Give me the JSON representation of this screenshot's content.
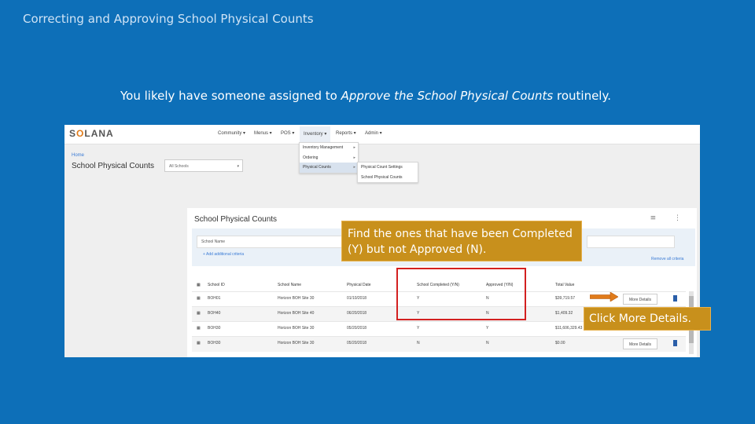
{
  "slide": {
    "title": "Correcting and Approving  School Physical Counts",
    "subtitle_pre": "You likely have someone assigned to ",
    "subtitle_em": "Approve the School Physical Counts",
    "subtitle_post": " routinely."
  },
  "app": {
    "logo_pre": "S",
    "logo_o": "O",
    "logo_post": "LANA",
    "nav": [
      "Community ▾",
      "Menus ▾",
      "POS ▾",
      "Inventory ▾",
      "Reports ▾",
      "Admin ▾"
    ],
    "inventory_menu": [
      {
        "label": "Inventory Management",
        "arrow": "▸"
      },
      {
        "label": "Ordering",
        "arrow": "▸"
      },
      {
        "label": "Physical Counts",
        "arrow": "▸"
      }
    ],
    "physical_counts_menu": [
      "Physical Count Settings",
      "School Physical Counts"
    ],
    "breadcrumb": "Home",
    "page_title": "School Physical Counts",
    "school_select": "All Schools",
    "school_select_caret": "▾"
  },
  "panel": {
    "title": "School Physical Counts",
    "icons": "≡ ⋮",
    "filter_placeholder": "School Name",
    "add_criteria": "+ Add additional criteria",
    "remove_all": "Remove all criteria",
    "columns": [
      "School ID",
      "School Name",
      "Physical Date",
      "School Completed (Y/N)",
      "Approved (Y/N)",
      "Total Value"
    ],
    "rows": [
      {
        "id": "BOH01",
        "name": "Horizon BOH Site 30",
        "date": "01/10/2018",
        "completed": "Y",
        "approved": "N",
        "total": "$39,719.57",
        "action": "More Details"
      },
      {
        "id": "BOH40",
        "name": "Horizon BOH Site 40",
        "date": "06/20/2018",
        "completed": "Y",
        "approved": "N",
        "total": "$1,409.32",
        "action": ""
      },
      {
        "id": "BOH30",
        "name": "Horizon BOH Site 30",
        "date": "05/20/2018",
        "completed": "Y",
        "approved": "Y",
        "total": "$11,606,329.43",
        "action": ""
      },
      {
        "id": "BOH30",
        "name": "Horizon BOH Site 30",
        "date": "05/20/2018",
        "completed": "N",
        "approved": "N",
        "total": "$0.00",
        "action": "More Details"
      }
    ]
  },
  "callouts": {
    "find": "Find the ones that have been Completed (Y) but not Approved (N).",
    "click": "Click More Details."
  },
  "colors": {
    "background": "#0d6fb8",
    "callout": "#c8901c",
    "highlight_box": "#d32020",
    "arrow": "#e07b1a"
  }
}
